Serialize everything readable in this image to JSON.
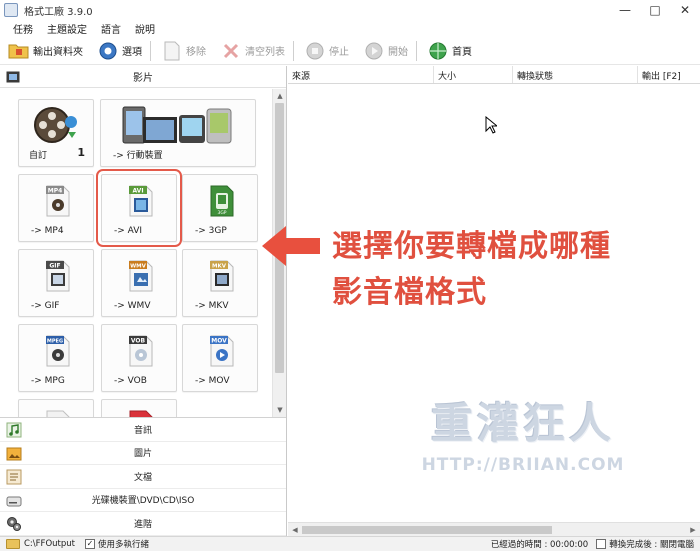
{
  "window": {
    "title": "格式工廠 3.9.0",
    "minimize": "—",
    "maximize": "□",
    "close": "✕"
  },
  "menu": [
    "任務",
    "主題設定",
    "語言",
    "說明"
  ],
  "toolbar": {
    "output_folder": "輸出資料夾",
    "options": "選項",
    "remove": "移除",
    "clear_list": "清空列表",
    "stop": "停止",
    "start": "開始",
    "home": "首頁"
  },
  "left": {
    "category": "影片",
    "tiles": [
      {
        "label": "自訂",
        "badge": "1",
        "icon": "film-reel-icon"
      },
      {
        "label": "-> 行動裝置",
        "icon": "mobile-devices-icon"
      },
      {
        "label": "-> MP4",
        "format": "MP4",
        "color": "#8a8a8a"
      },
      {
        "label": "-> AVI",
        "format": "AVI",
        "color": "#5a9a3a"
      },
      {
        "label": "-> 3GP",
        "format": "3GP",
        "color": "#3f8f3a"
      },
      {
        "label": "-> GIF",
        "format": "GIF",
        "color": "#4a4a4a"
      },
      {
        "label": "-> WMV",
        "format": "WMV",
        "color": "#c97c1e"
      },
      {
        "label": "-> MKV",
        "format": "MKV",
        "color": "#c9a24a"
      },
      {
        "label": "-> MPG",
        "format": "MPEG",
        "color": "#2c5ea8"
      },
      {
        "label": "-> VOB",
        "format": "VOB",
        "color": "#3b3b3b"
      },
      {
        "label": "-> MOV",
        "format": "MOV",
        "color": "#3b74c5"
      }
    ],
    "bottom_categories": [
      "音訊",
      "圖片",
      "文檔",
      "光碟機裝置\\DVD\\CD\\ISO",
      "進階"
    ]
  },
  "right": {
    "columns": [
      "來源",
      "大小",
      "轉換狀態",
      "輸出 [F2]"
    ]
  },
  "annotation": {
    "line1": "選擇你要轉檔成哪種",
    "line2": "影音檔格式",
    "color": "#e0503f"
  },
  "watermark": {
    "title": "重灌狂人",
    "url": "HTTP://BRIIAN.COM"
  },
  "status": {
    "output_path": "C:\\FFOutput",
    "multithread": "使用多執行緒",
    "elapsed": "已經過的時間 : 00:00:00",
    "after_convert": "轉換完成後 : 關閉電腦"
  }
}
